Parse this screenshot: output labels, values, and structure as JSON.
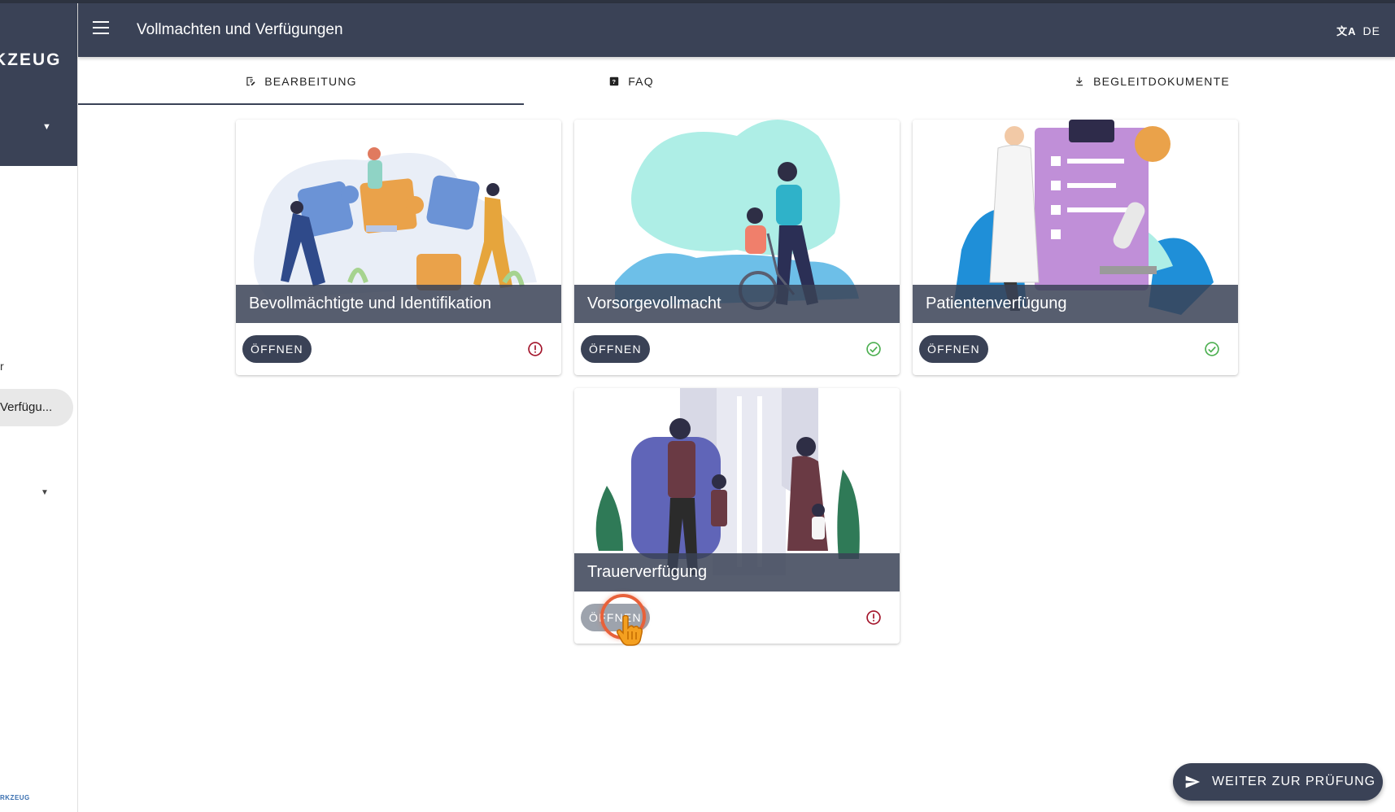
{
  "sidebar": {
    "brand": "KZEUG",
    "item_partial": "r",
    "active_item": "Verfügu...",
    "footer_brand": "RKZEUG"
  },
  "appbar": {
    "title": "Vollmachten und Verfügungen",
    "language": "DE"
  },
  "tabs": [
    {
      "label": "BEARBEITUNG",
      "icon": "edit-note-icon",
      "active": true
    },
    {
      "label": "FAQ",
      "icon": "help-box-icon",
      "active": false
    },
    {
      "label": "BEGLEITDOKUMENTE",
      "icon": "download-icon",
      "active": false
    }
  ],
  "cards": [
    {
      "title": "Bevollmächtigte und Identifikation",
      "button": "ÖFFNEN",
      "status": "error",
      "illustration": "puzzle-team"
    },
    {
      "title": "Vorsorgevollmacht",
      "button": "ÖFFNEN",
      "status": "done",
      "illustration": "wheelchair-care"
    },
    {
      "title": "Patientenverfügung",
      "button": "ÖFFNEN",
      "status": "done",
      "illustration": "doctor-clipboard"
    },
    {
      "title": "Trauerverfügung",
      "button": "ÖFFNEN",
      "status": "error",
      "illustration": "family-living-room"
    }
  ],
  "fab": {
    "label": "WEITER ZUR PRÜFUNG",
    "icon": "send-icon"
  },
  "colors": {
    "primary": "#3a4256",
    "error": "#a3142a",
    "success": "#4caf50",
    "cursor": "#e8613a"
  }
}
